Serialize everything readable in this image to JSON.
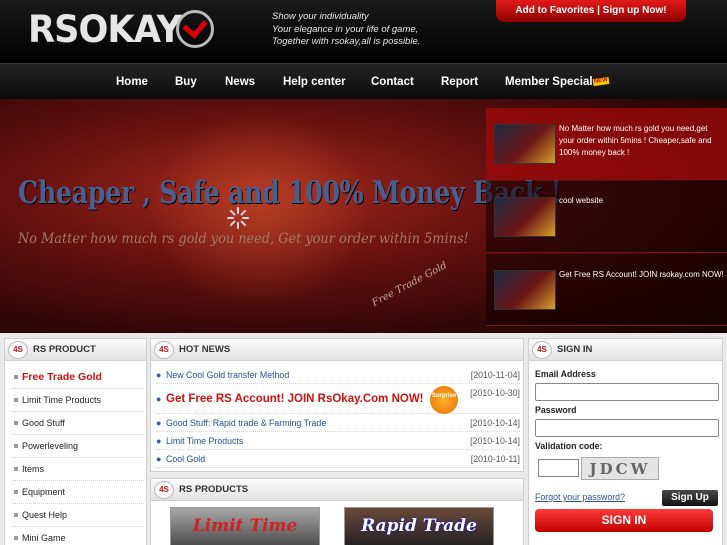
{
  "header": {
    "logo_text": "RSOKAY",
    "slogan": [
      "Show your individuality",
      "Your elegance in your life of game,",
      "Together with rsokay,all is possible."
    ],
    "favorites_link": "Add to Favorites | Sign up Now!"
  },
  "nav": {
    "items": [
      {
        "label": "Home"
      },
      {
        "label": "Buy"
      },
      {
        "label": "News"
      },
      {
        "label": "Help center"
      },
      {
        "label": "Contact"
      },
      {
        "label": "Report"
      },
      {
        "label": "Member Special"
      }
    ],
    "new_badge": "NEW"
  },
  "banner": {
    "headline": "Cheaper , Safe and 100% Money Back !",
    "subline": "No Matter how much rs gold you need, Get your order within 5mins!",
    "tag": "Free Trade Gold",
    "side_items": [
      {
        "text": "No Matter how much rs gold you need,get your order within 5mins ! Cheaper,safe and 100% money back !",
        "active": true
      },
      {
        "text": "cool website",
        "active": false
      },
      {
        "text": "Get Free RS Account! JOIN rsokay.com NOW!",
        "active": false
      }
    ]
  },
  "rs_product": {
    "badge": "4S",
    "title": "RS PRODUCT",
    "items": [
      {
        "label": "Free Trade Gold",
        "active": true
      },
      {
        "label": "Limit Time Products",
        "active": false
      },
      {
        "label": "Good Stuff",
        "active": false
      },
      {
        "label": "Powerleveling",
        "active": false
      },
      {
        "label": "Items",
        "active": false
      },
      {
        "label": "Equipment",
        "active": false
      },
      {
        "label": "Quest Help",
        "active": false
      },
      {
        "label": "Mini Game",
        "active": false
      }
    ]
  },
  "hot_news": {
    "badge": "4S",
    "title": "HOT NEWS",
    "items": [
      {
        "title": "New Cool Gold transfer Method",
        "date": "[2010-11-04]"
      },
      {
        "title": "Get Free RS Account! JOIN RsOkay.Com NOW!",
        "date": "[2010-10-30]",
        "badge": "Surprise"
      },
      {
        "title": "Good Stuff: Rapid trade & Farming Trade",
        "date": "[2010-10-14]"
      },
      {
        "title": "Limit Time Products",
        "date": "[2010-10-14]"
      },
      {
        "title": "Cool Gold",
        "date": "[2010-10-11]"
      }
    ]
  },
  "rs_products": {
    "badge": "4S",
    "title": "RS PRODUCTS",
    "cards": [
      "Limit Time",
      "Rapid Trade"
    ]
  },
  "sign_in": {
    "badge": "4S",
    "title": "SIGN IN",
    "email_label": "Email Address",
    "password_label": "Password",
    "validation_label": "Validation code:",
    "captcha": "JDCW",
    "forgot": "Forgot your password?",
    "signup": "Sign Up",
    "signin": "SIGN IN"
  }
}
